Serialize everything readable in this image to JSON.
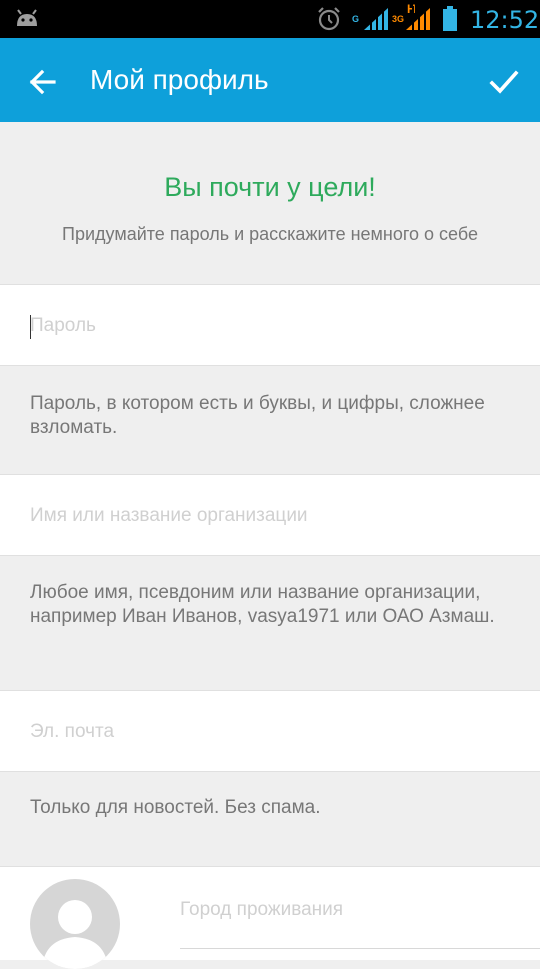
{
  "status_bar": {
    "time": "12:52",
    "icons": [
      "android-icon",
      "alarm-icon",
      "signal-icon",
      "signal-icon",
      "battery-icon"
    ],
    "net_labels": [
      "G",
      "3G",
      "H"
    ],
    "colors": {
      "time": "#33b5e5",
      "signal1": "#33b5e5",
      "signal2": "#ff8a00"
    }
  },
  "app_bar": {
    "title": "Мой профиль",
    "back_icon": "arrow-back-icon",
    "confirm_icon": "check-icon",
    "color": "#0ea0da"
  },
  "intro": {
    "headline": "Вы почти у цели!",
    "subtitle": "Придумайте пароль и расскажите немного о себе",
    "headline_color": "#2eaa5c"
  },
  "form": {
    "password": {
      "placeholder": "Пароль",
      "value": ""
    },
    "password_hint": "Пароль, в котором есть и буквы, и цифры, сложнее взломать.",
    "name": {
      "placeholder": "Имя или название организации",
      "value": ""
    },
    "name_hint": "Любое имя, псевдоним или название организации, например Иван Иванов, vasya1971 или ОАО Азмаш.",
    "email": {
      "placeholder": "Эл. почта",
      "value": ""
    },
    "email_hint": "Только для новостей. Без спама.",
    "city": {
      "placeholder": "Город проживания",
      "value": ""
    },
    "avatar_icon": "avatar-placeholder-icon"
  }
}
